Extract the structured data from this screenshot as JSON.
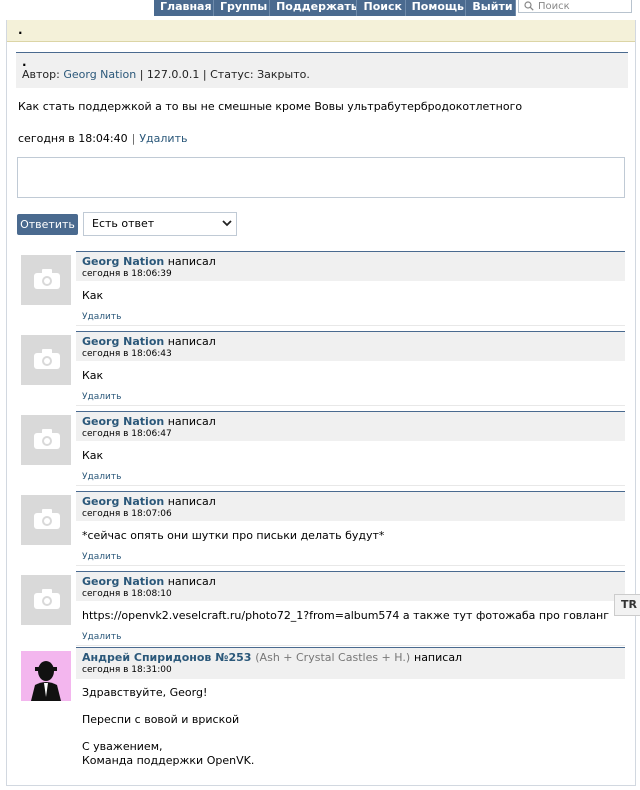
{
  "nav": {
    "items": [
      "Главная",
      "Группы",
      "Поддержать",
      "Поиск",
      "Помощь",
      "Выйти"
    ],
    "search_placeholder": "Поиск"
  },
  "notice": {
    "text": "."
  },
  "ticket": {
    "title": ".",
    "author_prefix": "Автор:",
    "author": "Georg Nation",
    "ip": "| 127.0.0.1 |",
    "status": "Статус: Закрыто.",
    "text": "Как стать поддержкой а то вы не смешные кроме Вовы ультрабутербродокотлетного",
    "time": "сегодня в 18:04:40",
    "separator": "|",
    "delete_label": "Удалить"
  },
  "reply": {
    "button_label": "Ответить",
    "status_selected": "Есть ответ"
  },
  "comments": [
    {
      "author": "Georg Nation",
      "suffix": "написал",
      "time": "сегодня в 18:06:39",
      "text": "Как",
      "delete_label": "Удалить"
    },
    {
      "author": "Georg Nation",
      "suffix": "написал",
      "time": "сегодня в 18:06:43",
      "text": "Как",
      "delete_label": "Удалить"
    },
    {
      "author": "Georg Nation",
      "suffix": "написал",
      "time": "сегодня в 18:06:47",
      "text": "Как",
      "delete_label": "Удалить"
    },
    {
      "author": "Georg Nation",
      "suffix": "написал",
      "time": "сегодня в 18:07:06",
      "text": "*сейчас опять они шутки про письки делать будут*",
      "delete_label": "Удалить"
    },
    {
      "author": "Georg Nation",
      "suffix": "написал",
      "time": "сегодня в 18:08:10",
      "text": "https://openvk2.veselcraft.ru/photo72_1?from=album574 а также тут фотожаба про говланг",
      "delete_label": "Удалить"
    }
  ],
  "support_reply": {
    "author": "Андрей Спиридонов №253",
    "band": "(Ash + Crystal Castles + H.)",
    "suffix": "написал",
    "time": "сегодня в 18:31:00",
    "greeting": "Здравствуйте, Georg!",
    "body": "Переспи с вовой и вриской",
    "closing1": "С уважением,",
    "closing2": "Команда поддержки OpenVK."
  },
  "side_tab": {
    "label": "TR"
  },
  "colors": {
    "nav": "#4a6a8f",
    "link": "#2b587a",
    "notice": "#f4f1d9",
    "header_bg": "#f0f0f0"
  }
}
